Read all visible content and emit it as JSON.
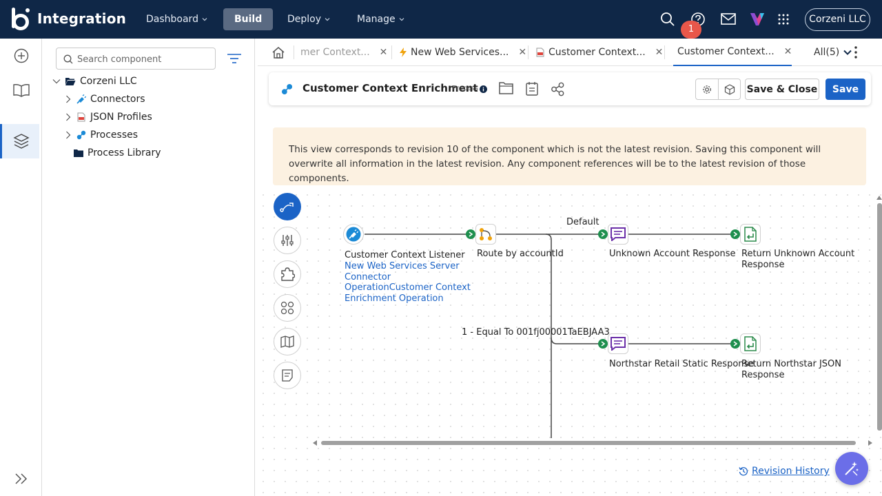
{
  "app": {
    "brand_name": "Integration",
    "account_label": "Corzeni LLC",
    "notification_count": "1"
  },
  "nav": {
    "items": [
      {
        "label": "Dashboard"
      },
      {
        "label": "Build"
      },
      {
        "label": "Deploy"
      },
      {
        "label": "Manage"
      }
    ],
    "active": "Build"
  },
  "tree": {
    "search_placeholder": "Search component",
    "root_label": "Corzeni LLC",
    "items": [
      {
        "label": "Connectors"
      },
      {
        "label": "JSON Profiles"
      },
      {
        "label": "Processes"
      },
      {
        "label": "Process Library"
      }
    ]
  },
  "tabs": {
    "items": [
      {
        "label": "mer Context..."
      },
      {
        "label": "New Web Services..."
      },
      {
        "label": "Customer Context..."
      },
      {
        "label": "Customer Context..."
      }
    ],
    "all_label": "All(5)"
  },
  "component": {
    "title": "Customer Context Enrichment",
    "type": "Process",
    "save_close_label": "Save & Close",
    "save_label": "Save"
  },
  "banner": {
    "text": "This view corresponds to revision 10 of the component which is not the latest revision. Saving this component will overwrite all information in the latest revision. Any component references will be to the latest revision of those components."
  },
  "canvas": {
    "start": {
      "label": "Customer Context Listener",
      "connector_link": "New Web Services Server Connector",
      "operation_link": "OperationCustomer Context Enrichment Operation"
    },
    "decision": {
      "label": "Route by accountId"
    },
    "default_label": "Default",
    "branch_label": "1 - Equal To 001fj00001TaEBJAA3",
    "shapes": [
      {
        "label": "Unknown Account Response"
      },
      {
        "label": "Return Unknown Account Response"
      },
      {
        "label": "Northstar Retail Static Response"
      },
      {
        "label": "Return Northstar JSON Response"
      }
    ]
  },
  "footer": {
    "revision_history_label": "Revision History"
  },
  "colors": {
    "nav_bg": "#0f2747",
    "primary": "#1b63c6",
    "banner_bg": "#fcf1e1",
    "connector_green": "#1e8f4e",
    "message_purple": "#6b2fa8",
    "fab": "#6b6ee8",
    "badge": "#e8574a"
  }
}
